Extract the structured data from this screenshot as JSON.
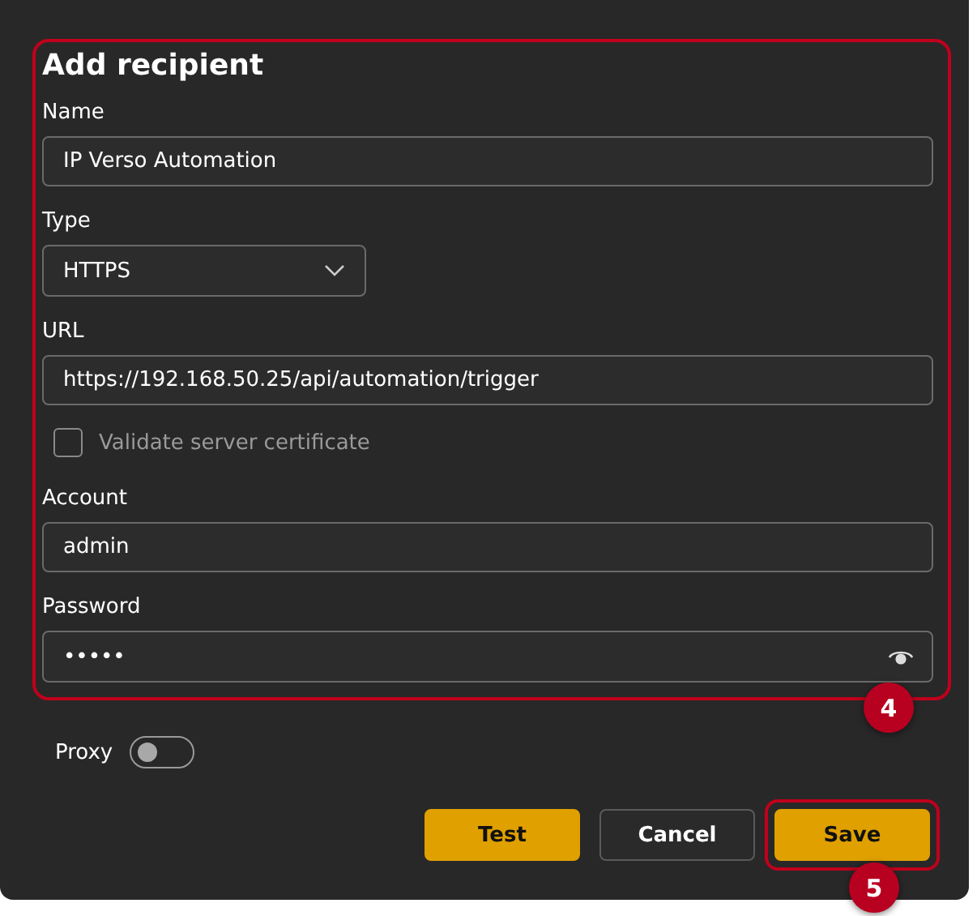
{
  "title": "Add recipient",
  "highlight": {
    "badge": "4"
  },
  "fields": [
    {
      "kind": "text",
      "label": "Name",
      "value": "IP Verso Automation"
    },
    {
      "kind": "select",
      "label": "Type",
      "value": "HTTPS"
    },
    {
      "kind": "text",
      "label": "URL",
      "value": "https://192.168.50.25/api/automation/trigger"
    },
    {
      "kind": "checkbox",
      "label": "Validate server certificate",
      "checked": false,
      "disabled": true
    },
    {
      "kind": "text",
      "label": "Account",
      "value": "admin"
    },
    {
      "kind": "password",
      "label": "Password",
      "value": "•••••"
    }
  ],
  "proxy": {
    "label": "Proxy",
    "on": false
  },
  "buttons": [
    {
      "label": "Test",
      "kind": "primary",
      "highlighted": false
    },
    {
      "label": "Cancel",
      "kind": "secondary",
      "highlighted": false
    },
    {
      "label": "Save",
      "kind": "primary",
      "highlighted": true,
      "badge": "5"
    }
  ]
}
